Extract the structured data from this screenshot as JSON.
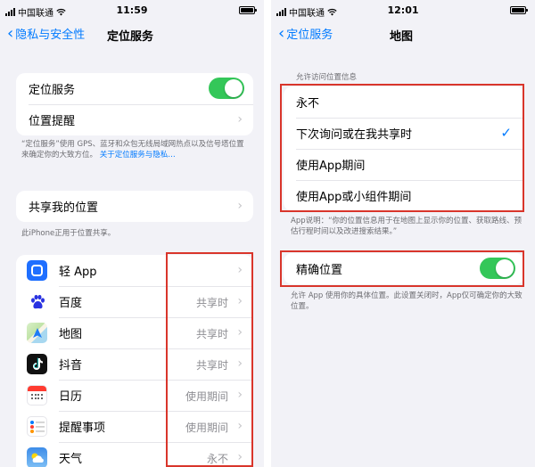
{
  "left": {
    "status": {
      "carrier": "中国联通",
      "time": "11:59"
    },
    "nav": {
      "back_label": "隐私与安全性",
      "title": "定位服务"
    },
    "location_group": {
      "location_services_label": "定位服务",
      "location_services_on": true,
      "location_alerts_label": "位置提醒"
    },
    "location_footnote": "“定位服务”使用 GPS、蓝牙和众包无线局域网热点以及信号塔位置来确定你的大致方位。",
    "location_footnote_link": "关于定位服务与隐私…",
    "share_group": {
      "share_label": "共享我的位置"
    },
    "share_footnote": "此iPhone正用于位置共享。",
    "apps": [
      {
        "name": "轻 App",
        "value": "",
        "icon": "light-app-icon"
      },
      {
        "name": "百度",
        "value": "共享时",
        "icon": "baidu-paw-icon"
      },
      {
        "name": "地图",
        "value": "共享时",
        "icon": "maps-icon"
      },
      {
        "name": "抖音",
        "value": "共享时",
        "icon": "douyin-note-icon"
      },
      {
        "name": "日历",
        "value": "使用期间",
        "icon": "calendar-icon"
      },
      {
        "name": "提醒事项",
        "value": "使用期间",
        "icon": "reminders-icon"
      },
      {
        "name": "天气",
        "value": "永不",
        "icon": "weather-icon"
      }
    ]
  },
  "right": {
    "status": {
      "carrier": "中国联通",
      "time": "12:01"
    },
    "nav": {
      "back_label": "定位服务",
      "title": "地图"
    },
    "access_header": "允许访问位置信息",
    "access_options": [
      {
        "label": "永不",
        "selected": false
      },
      {
        "label": "下次询问或在我共享时",
        "selected": true
      },
      {
        "label": "使用App期间",
        "selected": false
      },
      {
        "label": "使用App或小组件期间",
        "selected": false
      }
    ],
    "app_explanation": "App说明：“你的位置信息用于在地图上显示你的位置、获取路线、预估行程时间以及改进搜索结果。”",
    "precise_group": {
      "label": "精确位置",
      "on": true
    },
    "precise_footnote": "允许 App 使用你的具体位置。此设置关闭时，App仅可确定你的大致位置。"
  },
  "colors": {
    "accent": "#007aff",
    "toggle_on": "#34c759",
    "highlight": "#d9352b",
    "background": "#f2f2f7"
  }
}
